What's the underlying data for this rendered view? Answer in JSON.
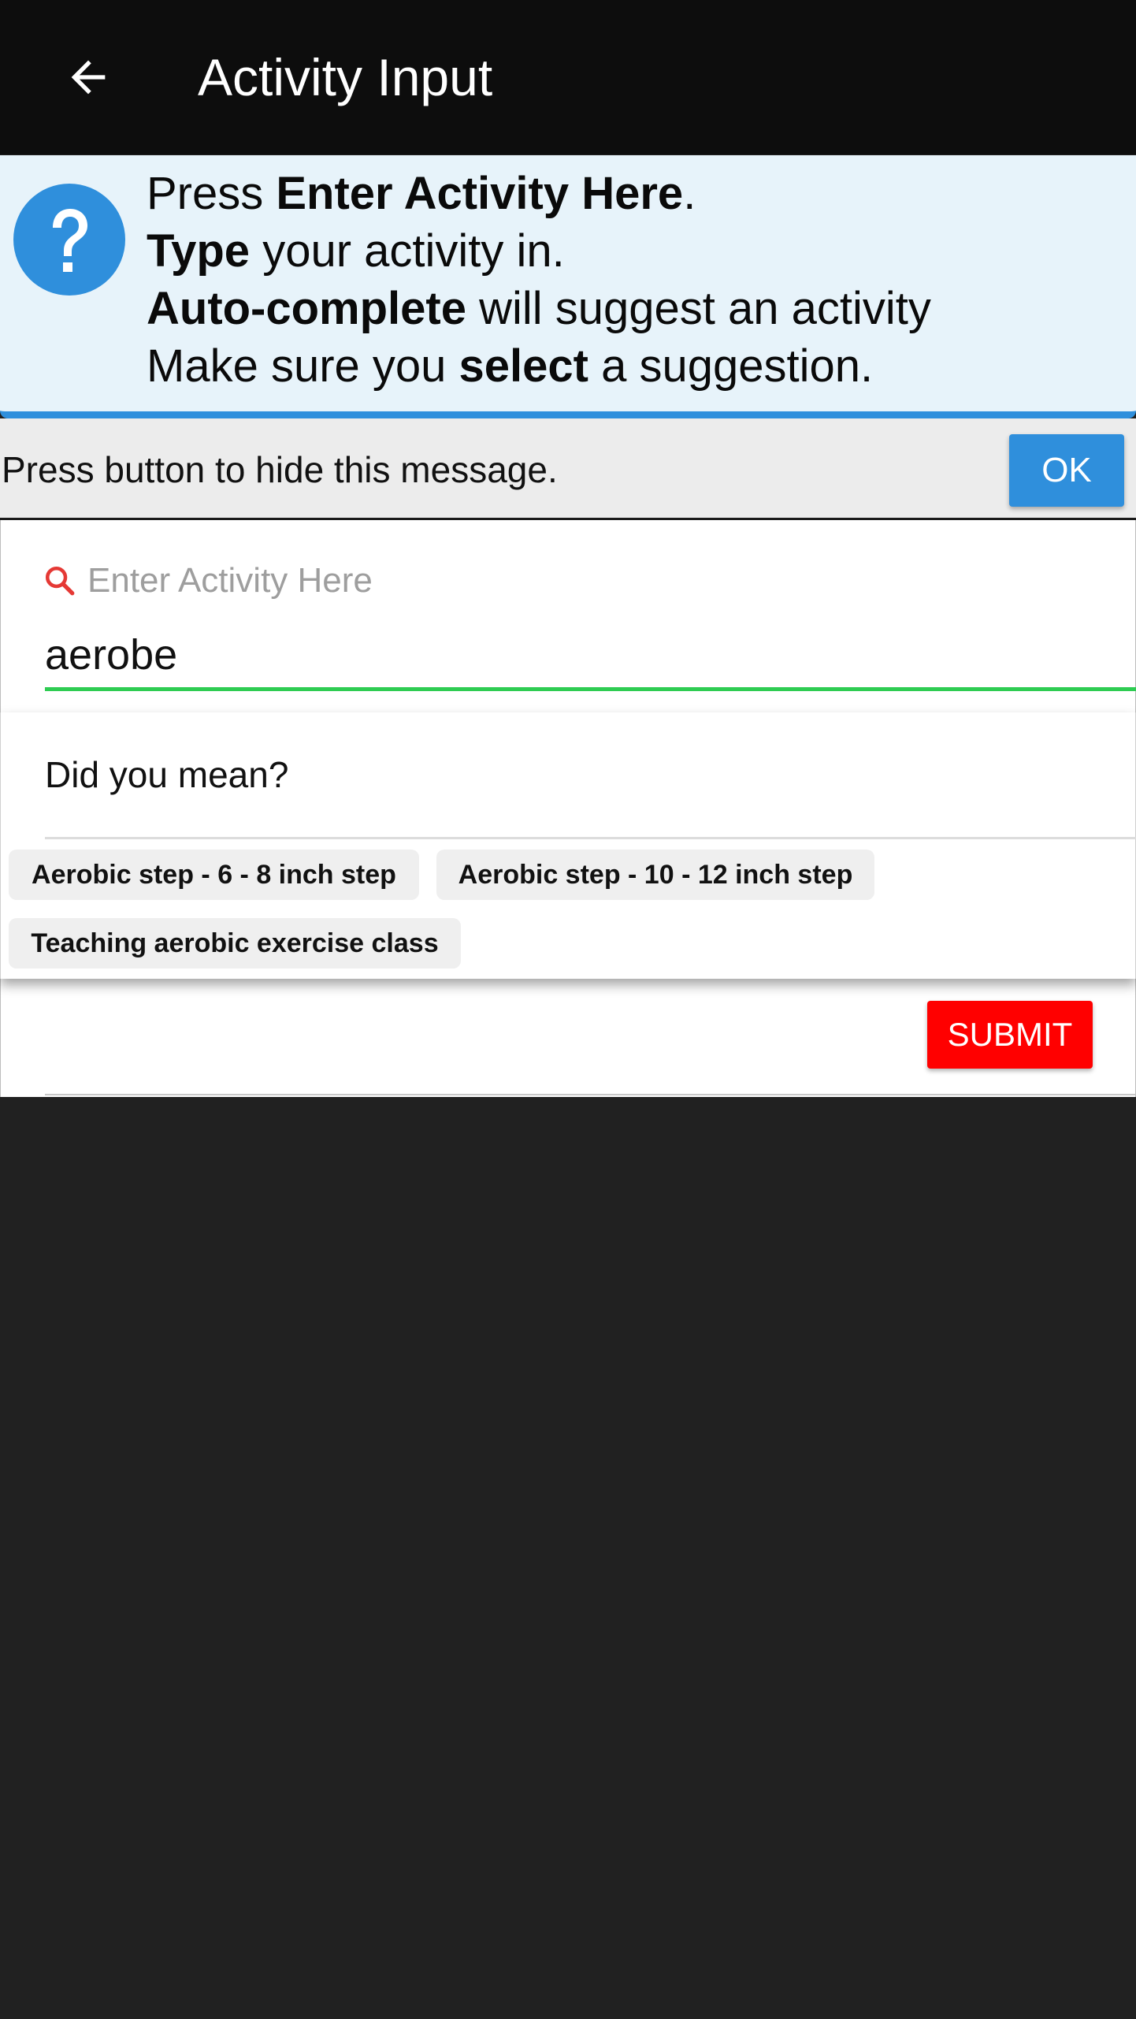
{
  "app_bar": {
    "title": "Activity Input",
    "background": "#0d0d0d"
  },
  "help": {
    "icon": "question-circle-icon",
    "accent": "#2f8fdc",
    "line1": {
      "a": "Press ",
      "b": "Enter Activity Here",
      "c": "."
    },
    "line2": {
      "b": "Type",
      "c": " your activity in."
    },
    "line3": {
      "b": "Auto-complete",
      "c": " will suggest an activity"
    },
    "line4": {
      "a": "Make sure you ",
      "b": "select",
      "c": " a suggestion."
    }
  },
  "dismiss": {
    "text": "Press button to hide this message.",
    "ok_label": "OK"
  },
  "search": {
    "label": "Enter Activity Here",
    "value": "aerobe",
    "icon": "search-icon",
    "underline_color": "#2ecc52"
  },
  "suggestions": {
    "title": "Did you mean?",
    "items": [
      "Aerobic step - 6 - 8 inch step",
      "Aerobic step - 10 - 12 inch step",
      "Teaching aerobic exercise class"
    ]
  },
  "submit_label": "SUBMIT",
  "submit_color": "#ff0000"
}
